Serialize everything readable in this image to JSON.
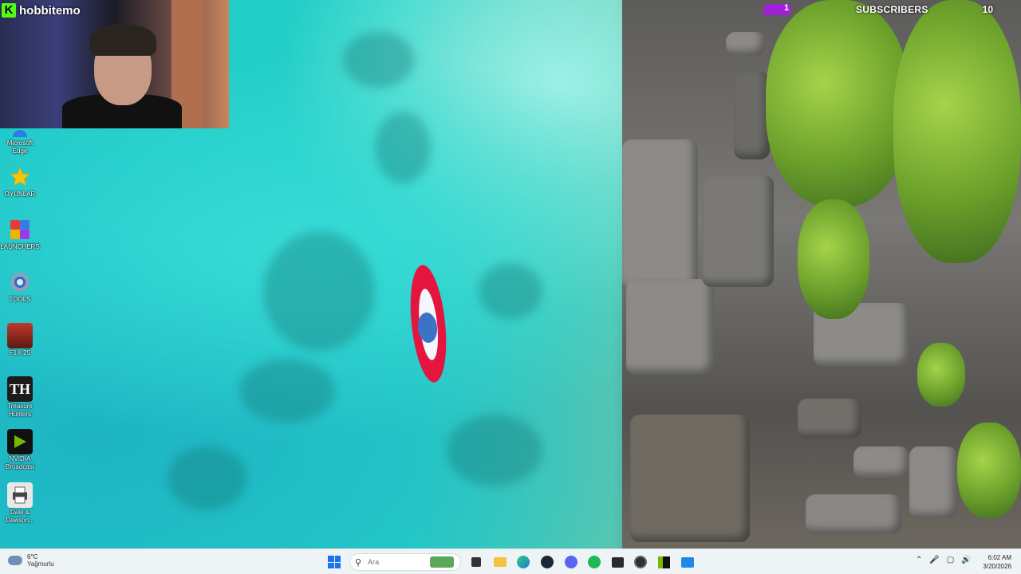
{
  "overlay": {
    "channel_name": "hobbitemo",
    "subscribers_label": "SUBSCRIBERS",
    "subscribers_current": "1",
    "subscribers_goal": "10",
    "subscribers_progress": 0.1,
    "kick_logo_letter": "K"
  },
  "desktop_icons": [
    {
      "label": "Microsoft Edge",
      "icon": "edge-icon"
    },
    {
      "label": "OYUNLAR",
      "icon": "star-icon"
    },
    {
      "label": "LAUNCHERS",
      "icon": "launchers-icon"
    },
    {
      "label": "TOOLS",
      "icon": "tools-icon"
    },
    {
      "label": "F1® 25",
      "icon": "f1-icon"
    },
    {
      "label": "Treasure Hunters",
      "icon": "treasure-hunter-icon"
    },
    {
      "label": "NVIDIA Broadcast",
      "icon": "nvidia-icon"
    },
    {
      "label": "Dale & Dawson...",
      "icon": "printer-icon"
    }
  ],
  "taskbar": {
    "weather_temp": "6°C",
    "weather_condition": "Yağmurlu",
    "search_placeholder": "Ara",
    "time": "6:02 AM",
    "date": "3/20/2026",
    "apps": [
      "start-icon",
      "search-icon",
      "task-view-icon",
      "file-explorer-icon",
      "edge-icon",
      "steam-icon",
      "discord-icon",
      "spotify-icon",
      "terminal-icon",
      "obs-icon",
      "nvidia-icon",
      "photos-icon"
    ]
  }
}
